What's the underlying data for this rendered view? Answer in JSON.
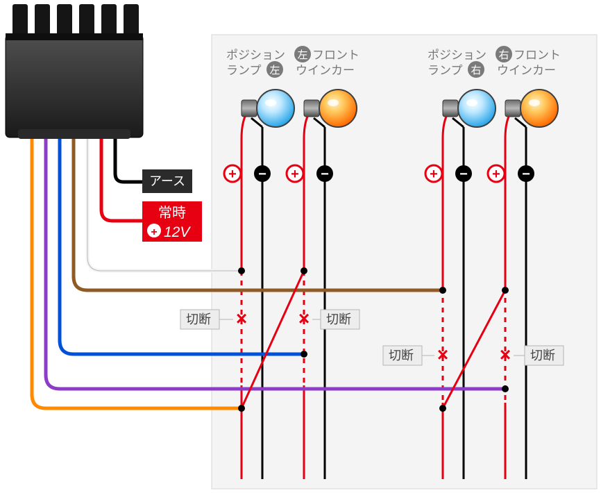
{
  "labels": {
    "pos_left_line1": "ポジション",
    "pos_left_line2": "ランプ",
    "winker_left_line1": "フロント",
    "winker_left_line2": "ウインカー",
    "pos_right_line1": "ポジション",
    "pos_right_line2": "ランプ",
    "winker_right_line1": "フロント",
    "winker_right_line2": "ウインカー",
    "badge_left": "左",
    "badge_right": "右",
    "earth": "アース",
    "const_line1": "常時",
    "const_line2_plus": "+",
    "const_line2_volt": "12V",
    "cut": "切断",
    "plus_sym": "+",
    "minus_sym": "−",
    "cross": "×"
  },
  "colors": {
    "panel": "#F4F4F4",
    "connector_dark": "#232323",
    "connector_light": "#4A4A4A",
    "red": "#E60012",
    "brown": "#8F5A24",
    "white_wire": "#F3F3F3",
    "blue": "#0051D7",
    "purple": "#8C3CC7",
    "orange": "#FF8A00",
    "black": "#000000",
    "label_gray": "#777777",
    "badge_gray": "#7A7A7A",
    "cut_bg": "#EDEDED",
    "cut_border": "#B5B5B5",
    "bulb_blue_light": "#BEE8FF",
    "bulb_blue_dark": "#2BA6E8",
    "bulb_orange_light": "#FFD27A",
    "bulb_orange_dark": "#FF7A00",
    "bulb_stroke": "#3E3E3E",
    "highlight": "#FFFFFF"
  }
}
